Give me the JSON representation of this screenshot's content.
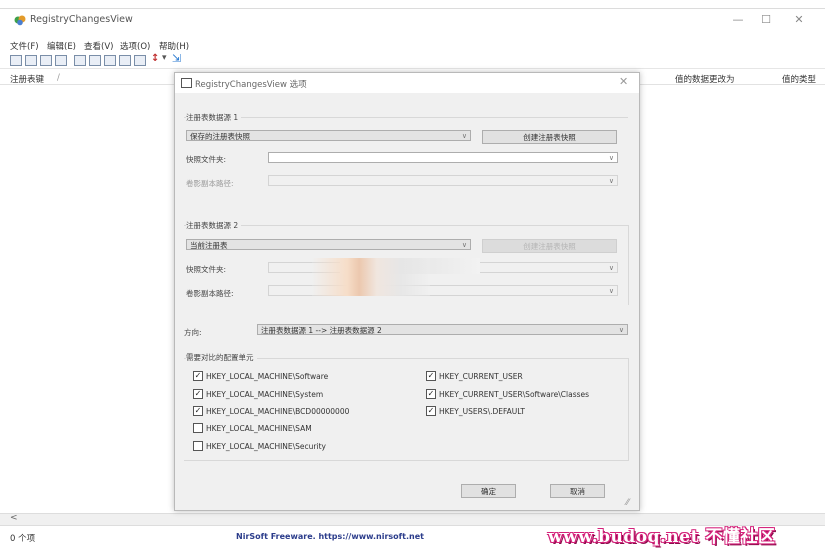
{
  "window": {
    "title": "RegistryChangesView",
    "controls": {
      "minimize": "—",
      "maximize": "☐",
      "close": "✕"
    }
  },
  "menu": [
    "文件(F)",
    "编辑(E)",
    "查看(V)",
    "选项(O)",
    "帮助(H)"
  ],
  "columns": {
    "key": "注册表键",
    "sort": "/",
    "changed_to": "值的数据更改为",
    "type": "值的类型"
  },
  "status": {
    "count": "0 个项",
    "freeware": "NirSoft Freeware. https://www.nirsoft.net",
    "scroll_left": "<"
  },
  "watermark": "www.budoq.net 不懂社区",
  "dialog": {
    "title": "RegistryChangesView 选项",
    "close": "✕",
    "source1": {
      "group": "注册表数据源 1",
      "type_value": "保存的注册表快照",
      "create_button": "创建注册表快照",
      "folder_label": "快照文件夹:",
      "folder_value": "",
      "shadow_label": "卷影副本路径:",
      "shadow_value": ""
    },
    "source2": {
      "group": "注册表数据源 2",
      "type_value": "当前注册表",
      "create_button": "创建注册表快照",
      "folder_label": "快照文件夹:",
      "shadow_label": "卷影副本路径:"
    },
    "direction": {
      "label": "方向:",
      "value": "注册表数据源 1 --> 注册表数据源 2"
    },
    "hives": {
      "group": "需要对比的配置单元",
      "items": [
        {
          "label": "HKEY_LOCAL_MACHINE\\Software",
          "checked": "✓"
        },
        {
          "label": "HKEY_LOCAL_MACHINE\\System",
          "checked": "✓"
        },
        {
          "label": "HKEY_LOCAL_MACHINE\\BCD00000000",
          "checked": "✓"
        },
        {
          "label": "HKEY_LOCAL_MACHINE\\SAM",
          "checked": ""
        },
        {
          "label": "HKEY_LOCAL_MACHINE\\Security",
          "checked": ""
        },
        {
          "label": "HKEY_CURRENT_USER",
          "checked": "✓"
        },
        {
          "label": "HKEY_CURRENT_USER\\Software\\Classes",
          "checked": "✓"
        },
        {
          "label": "HKEY_USERS\\.DEFAULT",
          "checked": "✓"
        }
      ]
    },
    "ok": "确定",
    "cancel": "取消",
    "grip": "⁄⁄"
  },
  "icons": {
    "app": "registry-changes-app-icon",
    "combo_arrow": "∨"
  }
}
